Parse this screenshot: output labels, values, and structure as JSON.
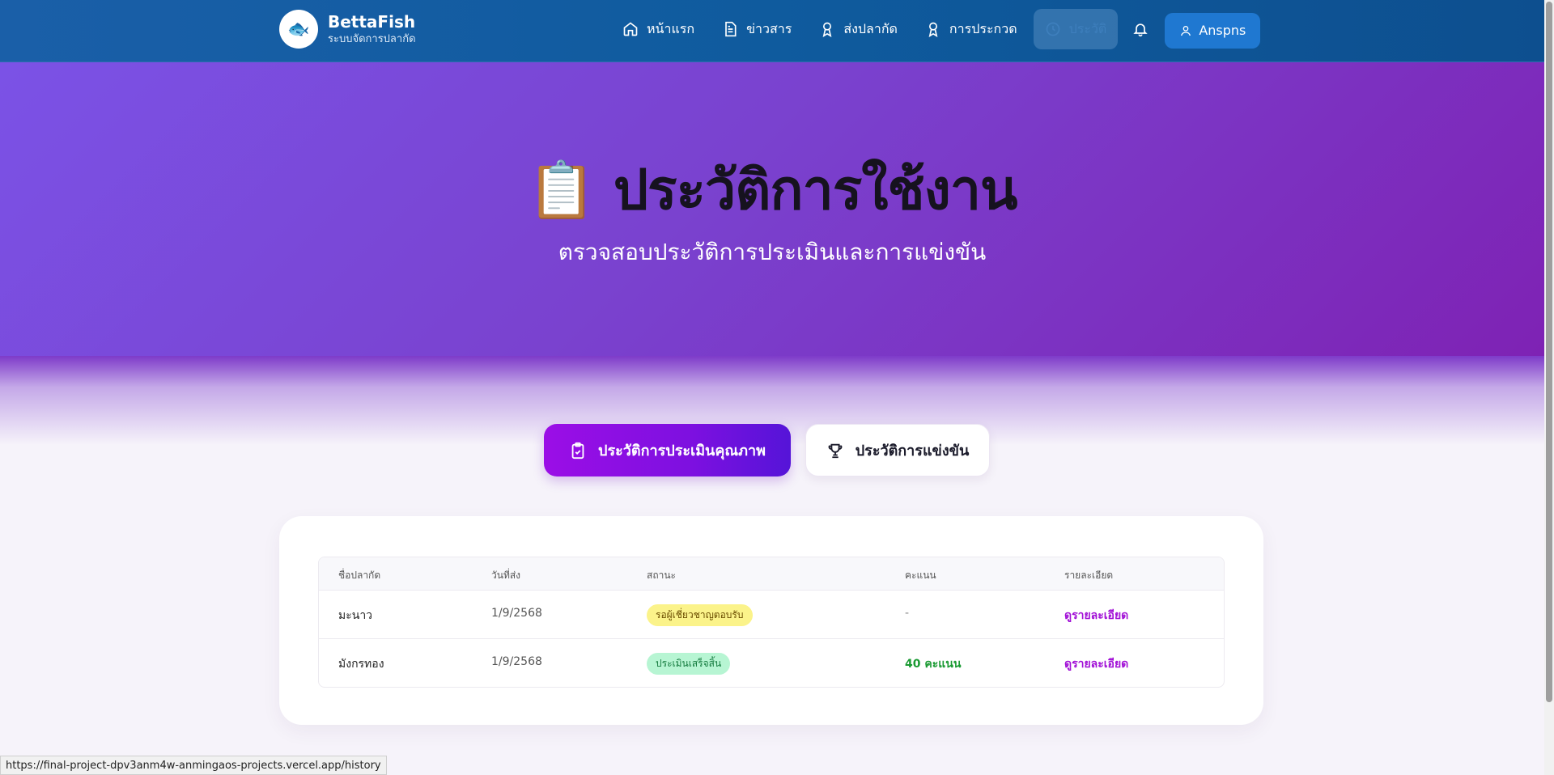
{
  "brand": {
    "name": "BettaFish",
    "subtitle": "ระบบจัดการปลากัด",
    "logo_icon": "fish-icon"
  },
  "nav": {
    "items": [
      {
        "label": "หน้าแรก",
        "icon": "home-icon"
      },
      {
        "label": "ข่าวสาร",
        "icon": "document-icon"
      },
      {
        "label": "ส่งปลากัด",
        "icon": "award-icon"
      },
      {
        "label": "การประกวด",
        "icon": "award-icon"
      },
      {
        "label": "ประวัติ",
        "icon": "clock-icon",
        "active": true
      }
    ],
    "bell_icon": "bell-icon",
    "user": {
      "label": "Anspns",
      "icon": "user-icon"
    }
  },
  "hero": {
    "emoji": "📋",
    "title": "ประวัติการใช้งาน",
    "subtitle": "ตรวจสอบประวัติการประเมินและการแข่งขัน"
  },
  "tabs": [
    {
      "label": "ประวัติการประเมินคุณภาพ",
      "icon": "clipboard-icon",
      "active": true
    },
    {
      "label": "ประวัติการแข่งขัน",
      "icon": "trophy-icon",
      "active": false
    }
  ],
  "table": {
    "headers": {
      "name": "ชื่อปลากัด",
      "date": "วันที่ส่ง",
      "status": "สถานะ",
      "score": "คะแนน",
      "detail": "รายละเอียด"
    },
    "rows": [
      {
        "name": "มะนาว",
        "date": "1/9/2568",
        "status": "รอผู้เชี่ยวชาญตอบรับ",
        "score": "-",
        "detail": "ดูรายละเอียด"
      },
      {
        "name": "มังกรทอง",
        "date": "1/9/2568",
        "status": "ประเมินเสร็จสิ้น",
        "score": "40 คะแนน",
        "detail": "ดูรายละเอียด"
      }
    ]
  },
  "status_bar": {
    "url": "https://final-project-dpv3anm4w-anmingaos-projects.vercel.app/history"
  },
  "colors": {
    "nav_bg": "#0f5b9e",
    "accent": "#9b0ee6",
    "user_btn": "#1f78d1",
    "success": "#1a9a32",
    "link": "#a10fd6"
  }
}
